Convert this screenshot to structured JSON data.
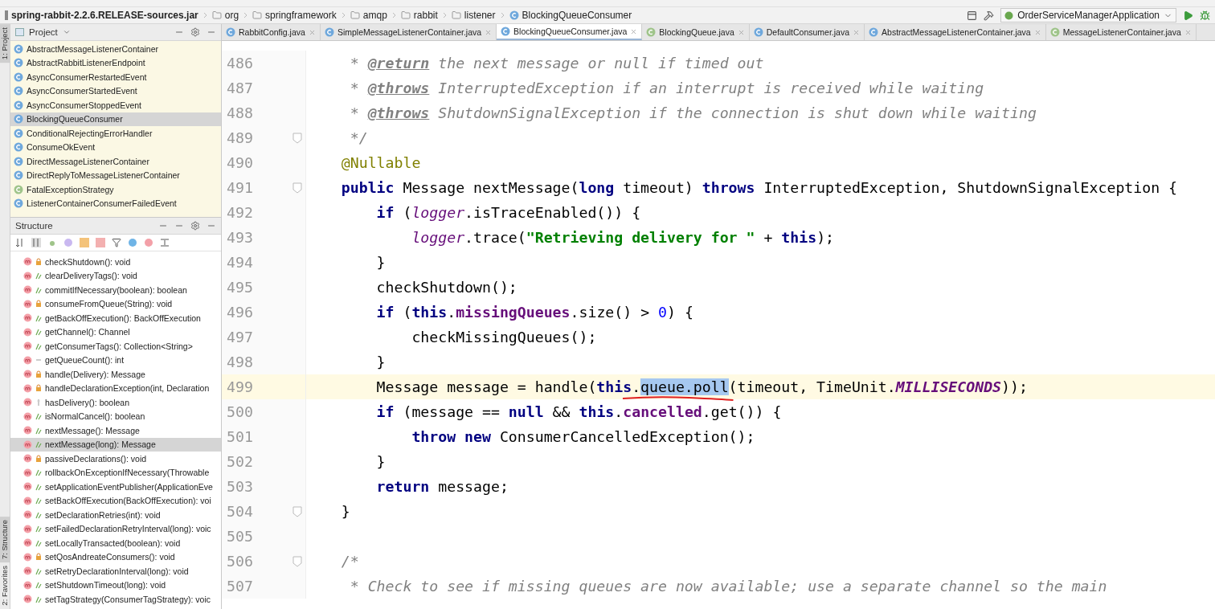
{
  "nav_bar": {
    "crumbs": [
      {
        "label": "spring-rabbit-2.2.6.RELEASE-sources.jar",
        "kind": "jar"
      },
      {
        "label": "org",
        "kind": "package"
      },
      {
        "label": "springframework",
        "kind": "package"
      },
      {
        "label": "amqp",
        "kind": "package"
      },
      {
        "label": "rabbit",
        "kind": "package"
      },
      {
        "label": "listener",
        "kind": "package"
      },
      {
        "label": "BlockingQueueConsumer",
        "kind": "class"
      }
    ],
    "run_config": "OrderServiceManagerApplication"
  },
  "side_stripe": [
    {
      "label": "1: Project",
      "selected": true
    },
    {
      "label": "7: Structure",
      "selected": true
    },
    {
      "label": "2: Favorites",
      "selected": false
    }
  ],
  "project_panel": {
    "title": "Project",
    "items": [
      {
        "label": "AbstractMessageListenerContainer",
        "kind": "class",
        "selected": false
      },
      {
        "label": "AbstractRabbitListenerEndpoint",
        "kind": "class",
        "selected": false
      },
      {
        "label": "AsyncConsumerRestartedEvent",
        "kind": "class",
        "selected": false
      },
      {
        "label": "AsyncConsumerStartedEvent",
        "kind": "class",
        "selected": false
      },
      {
        "label": "AsyncConsumerStoppedEvent",
        "kind": "class",
        "selected": false
      },
      {
        "label": "BlockingQueueConsumer",
        "kind": "class",
        "selected": true
      },
      {
        "label": "ConditionalRejectingErrorHandler",
        "kind": "class",
        "selected": false
      },
      {
        "label": "ConsumeOkEvent",
        "kind": "class",
        "selected": false
      },
      {
        "label": "DirectMessageListenerContainer",
        "kind": "class",
        "selected": false
      },
      {
        "label": "DirectReplyToMessageListenerContainer",
        "kind": "class",
        "selected": false
      },
      {
        "label": "FatalExceptionStrategy",
        "kind": "interface",
        "selected": false
      },
      {
        "label": "ListenerContainerConsumerFailedEvent",
        "kind": "class",
        "selected": false
      }
    ]
  },
  "structure_panel": {
    "title": "Structure",
    "items": [
      {
        "label": "checkShutdown(): void",
        "kind": "private",
        "selected": false
      },
      {
        "label": "clearDeliveryTags(): void",
        "kind": "public",
        "selected": false
      },
      {
        "label": "commitIfNecessary(boolean): boolean",
        "kind": "public",
        "selected": false
      },
      {
        "label": "consumeFromQueue(String): void",
        "kind": "private",
        "selected": false
      },
      {
        "label": "getBackOffExecution(): BackOffExecution",
        "kind": "public",
        "selected": false
      },
      {
        "label": "getChannel(): Channel",
        "kind": "public",
        "selected": false
      },
      {
        "label": "getConsumerTags(): Collection<String>",
        "kind": "public",
        "selected": false
      },
      {
        "label": "getQueueCount(): int",
        "kind": "package",
        "selected": false
      },
      {
        "label": "handle(Delivery): Message",
        "kind": "private",
        "selected": false
      },
      {
        "label": "handleDeclarationException(int, Declaration",
        "kind": "private",
        "selected": false
      },
      {
        "label": "hasDelivery(): boolean",
        "kind": "protected",
        "selected": false
      },
      {
        "label": "isNormalCancel(): boolean",
        "kind": "public",
        "selected": false
      },
      {
        "label": "nextMessage(): Message",
        "kind": "public",
        "selected": false
      },
      {
        "label": "nextMessage(long): Message",
        "kind": "public",
        "selected": true
      },
      {
        "label": "passiveDeclarations(): void",
        "kind": "private",
        "selected": false
      },
      {
        "label": "rollbackOnExceptionIfNecessary(Throwable",
        "kind": "public",
        "selected": false
      },
      {
        "label": "setApplicationEventPublisher(ApplicationEve",
        "kind": "public",
        "selected": false
      },
      {
        "label": "setBackOffExecution(BackOffExecution): voi",
        "kind": "public",
        "selected": false
      },
      {
        "label": "setDeclarationRetries(int): void",
        "kind": "public",
        "selected": false
      },
      {
        "label": "setFailedDeclarationRetryInterval(long): voic",
        "kind": "public",
        "selected": false
      },
      {
        "label": "setLocallyTransacted(boolean): void",
        "kind": "public",
        "selected": false
      },
      {
        "label": "setQosAndreateConsumers(): void",
        "kind": "private",
        "selected": false
      },
      {
        "label": "setRetryDeclarationInterval(long): void",
        "kind": "public",
        "selected": false
      },
      {
        "label": "setShutdownTimeout(long): void",
        "kind": "public",
        "selected": false
      },
      {
        "label": "setTagStrategy(ConsumerTagStrategy): voic",
        "kind": "public",
        "selected": false
      }
    ]
  },
  "editor_tabs": [
    {
      "label": "RabbitConfig.java",
      "kind": "class",
      "selected": false
    },
    {
      "label": "SimpleMessageListenerContainer.java",
      "kind": "class",
      "selected": false
    },
    {
      "label": "BlockingQueueConsumer.java",
      "kind": "class",
      "selected": true
    },
    {
      "label": "BlockingQueue.java",
      "kind": "interface",
      "selected": false
    },
    {
      "label": "DefaultConsumer.java",
      "kind": "class",
      "selected": false
    },
    {
      "label": "AbstractMessageListenerContainer.java",
      "kind": "class",
      "selected": false
    },
    {
      "label": "MessageListenerContainer.java",
      "kind": "interface",
      "selected": false
    }
  ],
  "code_lines": [
    {
      "number": "486",
      "current": false,
      "tokens": [
        {
          "text": "     * ",
          "kind": "comment"
        },
        {
          "text": "@return",
          "kind": "doctag"
        },
        {
          "text": " the next message or null if timed out",
          "kind": "comment"
        }
      ]
    },
    {
      "number": "487",
      "current": false,
      "tokens": [
        {
          "text": "     * ",
          "kind": "comment"
        },
        {
          "text": "@throws",
          "kind": "doctag"
        },
        {
          "text": " InterruptedException if an interrupt is received while waiting",
          "kind": "comment"
        }
      ]
    },
    {
      "number": "488",
      "current": false,
      "tokens": [
        {
          "text": "     * ",
          "kind": "comment"
        },
        {
          "text": "@throws",
          "kind": "doctag"
        },
        {
          "text": " ShutdownSignalException if the connection is shut down while waiting",
          "kind": "comment"
        }
      ]
    },
    {
      "number": "489",
      "current": false,
      "fold": true,
      "tokens": [
        {
          "text": "     */",
          "kind": "comment"
        }
      ]
    },
    {
      "number": "490",
      "current": false,
      "tokens": [
        {
          "text": "    @Nullable",
          "kind": "annotation"
        }
      ]
    },
    {
      "number": "491",
      "current": false,
      "fold": true,
      "tokens": [
        {
          "text": "    public",
          "kind": "keyword"
        },
        {
          "text": " Message nextMessage(",
          "kind": "plain"
        },
        {
          "text": "long",
          "kind": "keyword"
        },
        {
          "text": " timeout) ",
          "kind": "plain"
        },
        {
          "text": "throws",
          "kind": "keyword"
        },
        {
          "text": " InterruptedException, ShutdownSignalException {",
          "kind": "plain"
        }
      ]
    },
    {
      "number": "492",
      "current": false,
      "tokens": [
        {
          "text": "        if",
          "kind": "keyword"
        },
        {
          "text": " (",
          "kind": "plain"
        },
        {
          "text": "logger",
          "kind": "static"
        },
        {
          "text": ".isTraceEnabled()) {",
          "kind": "plain"
        }
      ]
    },
    {
      "number": "493",
      "current": false,
      "tokens": [
        {
          "text": "            logger",
          "kind": "static"
        },
        {
          "text": ".trace(",
          "kind": "plain"
        },
        {
          "text": "\"Retrieving delivery for \"",
          "kind": "string"
        },
        {
          "text": " + ",
          "kind": "plain"
        },
        {
          "text": "this",
          "kind": "keyword"
        },
        {
          "text": ");",
          "kind": "plain"
        }
      ]
    },
    {
      "number": "494",
      "current": false,
      "tokens": [
        {
          "text": "        }",
          "kind": "plain"
        }
      ]
    },
    {
      "number": "495",
      "current": false,
      "tokens": [
        {
          "text": "        checkShutdown();",
          "kind": "plain"
        }
      ]
    },
    {
      "number": "496",
      "current": false,
      "tokens": [
        {
          "text": "        if",
          "kind": "keyword"
        },
        {
          "text": " (",
          "kind": "plain"
        },
        {
          "text": "this",
          "kind": "keyword"
        },
        {
          "text": ".",
          "kind": "plain"
        },
        {
          "text": "missingQueues",
          "kind": "field"
        },
        {
          "text": ".size() > ",
          "kind": "plain"
        },
        {
          "text": "0",
          "kind": "number"
        },
        {
          "text": ") {",
          "kind": "plain"
        }
      ]
    },
    {
      "number": "497",
      "current": false,
      "tokens": [
        {
          "text": "            checkMissingQueues();",
          "kind": "plain"
        }
      ]
    },
    {
      "number": "498",
      "current": false,
      "tokens": [
        {
          "text": "        }",
          "kind": "plain"
        }
      ]
    },
    {
      "number": "499",
      "current": true,
      "tokens": [
        {
          "text": "        Message message = handle(",
          "kind": "plain"
        },
        {
          "text": "this",
          "kind": "keyword"
        },
        {
          "text": ".",
          "kind": "plain"
        },
        {
          "text": "queue.poll",
          "kind": "selection",
          "marked": true
        },
        {
          "text": "(timeout, TimeUnit.",
          "kind": "plain"
        },
        {
          "text": "MILLISECONDS",
          "kind": "constant"
        },
        {
          "text": "));",
          "kind": "plain"
        }
      ]
    },
    {
      "number": "500",
      "current": false,
      "tokens": [
        {
          "text": "        if",
          "kind": "keyword"
        },
        {
          "text": " (message == ",
          "kind": "plain"
        },
        {
          "text": "null",
          "kind": "keyword"
        },
        {
          "text": " && ",
          "kind": "plain"
        },
        {
          "text": "this",
          "kind": "keyword"
        },
        {
          "text": ".",
          "kind": "plain"
        },
        {
          "text": "cancelled",
          "kind": "field"
        },
        {
          "text": ".get()) {",
          "kind": "plain"
        }
      ]
    },
    {
      "number": "501",
      "current": false,
      "tokens": [
        {
          "text": "            throw new",
          "kind": "keyword"
        },
        {
          "text": " ConsumerCancelledException();",
          "kind": "plain"
        }
      ]
    },
    {
      "number": "502",
      "current": false,
      "tokens": [
        {
          "text": "        }",
          "kind": "plain"
        }
      ]
    },
    {
      "number": "503",
      "current": false,
      "tokens": [
        {
          "text": "        return",
          "kind": "keyword"
        },
        {
          "text": " message;",
          "kind": "plain"
        }
      ]
    },
    {
      "number": "504",
      "current": false,
      "fold": true,
      "tokens": [
        {
          "text": "    }",
          "kind": "plain"
        }
      ]
    },
    {
      "number": "505",
      "current": false
    },
    {
      "number": "506",
      "current": false,
      "fold": true,
      "tokens": [
        {
          "text": "    /*",
          "kind": "comment"
        }
      ]
    },
    {
      "number": "507",
      "current": false,
      "tokens": [
        {
          "text": "     * Check to see if missing queues are now available; use a separate channel so the main",
          "kind": "comment"
        }
      ]
    }
  ]
}
